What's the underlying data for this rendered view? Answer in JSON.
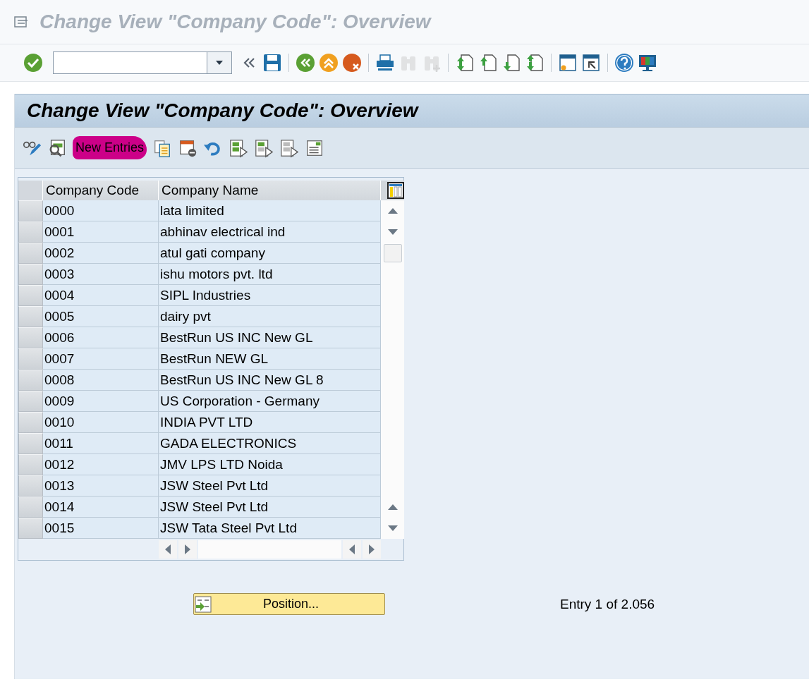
{
  "window": {
    "title": "Change View \"Company Code\": Overview"
  },
  "system_toolbar": {
    "items": [
      {
        "kind": "enter",
        "disabled": false
      },
      {
        "kind": "collapse",
        "disabled": false
      },
      {
        "kind": "save",
        "disabled": false
      },
      {
        "kind": "back",
        "disabled": false
      },
      {
        "kind": "exit",
        "disabled": false
      },
      {
        "kind": "cancel",
        "disabled": false
      },
      {
        "kind": "print",
        "disabled": false
      },
      {
        "kind": "find",
        "disabled": true
      },
      {
        "kind": "find-next",
        "disabled": true
      },
      {
        "kind": "first-page",
        "disabled": false
      },
      {
        "kind": "prev-page",
        "disabled": false
      },
      {
        "kind": "next-page",
        "disabled": false
      },
      {
        "kind": "last-page",
        "disabled": false
      },
      {
        "kind": "new-session",
        "disabled": false
      },
      {
        "kind": "shortcut",
        "disabled": false
      },
      {
        "kind": "help",
        "disabled": false
      },
      {
        "kind": "layout",
        "disabled": false
      }
    ]
  },
  "screen": {
    "title": "Change View \"Company Code\": Overview",
    "app_toolbar": [
      {
        "kind": "display-change"
      },
      {
        "kind": "details"
      },
      {
        "kind": "text",
        "label": "New Entries",
        "highlighted": true
      },
      {
        "kind": "copy"
      },
      {
        "kind": "delete"
      },
      {
        "kind": "undo"
      },
      {
        "kind": "select-all"
      },
      {
        "kind": "select-block"
      },
      {
        "kind": "deselect-all"
      },
      {
        "kind": "config"
      }
    ]
  },
  "table": {
    "columns": [
      "Company Code",
      "Company Name"
    ],
    "rows": [
      {
        "code": "0000",
        "name": "lata limited"
      },
      {
        "code": "0001",
        "name": "abhinav electrical ind"
      },
      {
        "code": "0002",
        "name": "atul gati company"
      },
      {
        "code": "0003",
        "name": "ishu motors pvt. ltd"
      },
      {
        "code": "0004",
        "name": "SIPL Industries"
      },
      {
        "code": "0005",
        "name": "dairy pvt"
      },
      {
        "code": "0006",
        "name": "BestRun US INC New GL"
      },
      {
        "code": "0007",
        "name": "BestRun NEW GL"
      },
      {
        "code": "0008",
        "name": "BestRun US INC New GL 8"
      },
      {
        "code": "0009",
        "name": "US Corporation - Germany"
      },
      {
        "code": "0010",
        "name": "INDIA PVT LTD"
      },
      {
        "code": "0011",
        "name": "GADA ELECTRONICS"
      },
      {
        "code": "0012",
        "name": "JMV LPS LTD Noida"
      },
      {
        "code": "0013",
        "name": "JSW Steel Pvt Ltd"
      },
      {
        "code": "0014",
        "name": "JSW Steel Pvt Ltd"
      },
      {
        "code": "0015",
        "name": "JSW Tata Steel Pvt Ltd"
      }
    ]
  },
  "position_button": {
    "label": "Position..."
  },
  "entry_info": "Entry 1 of 2.056"
}
